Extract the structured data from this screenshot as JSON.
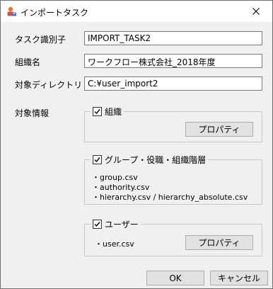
{
  "window": {
    "title": "インポートタスク"
  },
  "form": {
    "task_id_label": "タスク識別子",
    "task_id_value": "IMPORT_TASK2",
    "org_name_label": "組織名",
    "org_name_value": "ワークフロー株式会社_2018年度",
    "target_dir_label": "対象ディレクトリ",
    "target_dir_value": "C:¥user_import2",
    "target_info_label": "対象情報"
  },
  "groups": {
    "org": {
      "label": "組織",
      "checked": true,
      "button": "プロパティ"
    },
    "group_role": {
      "label": "グループ・役職・組織階層",
      "checked": true,
      "files": [
        "・group.csv",
        "・authority.csv",
        "・hierarchy.csv / hierarchy_absolute.csv"
      ]
    },
    "user": {
      "label": "ユーザー",
      "checked": true,
      "file": "・user.csv",
      "button": "プロパティ"
    }
  },
  "footer": {
    "ok": "OK",
    "cancel": "キャンセル"
  }
}
